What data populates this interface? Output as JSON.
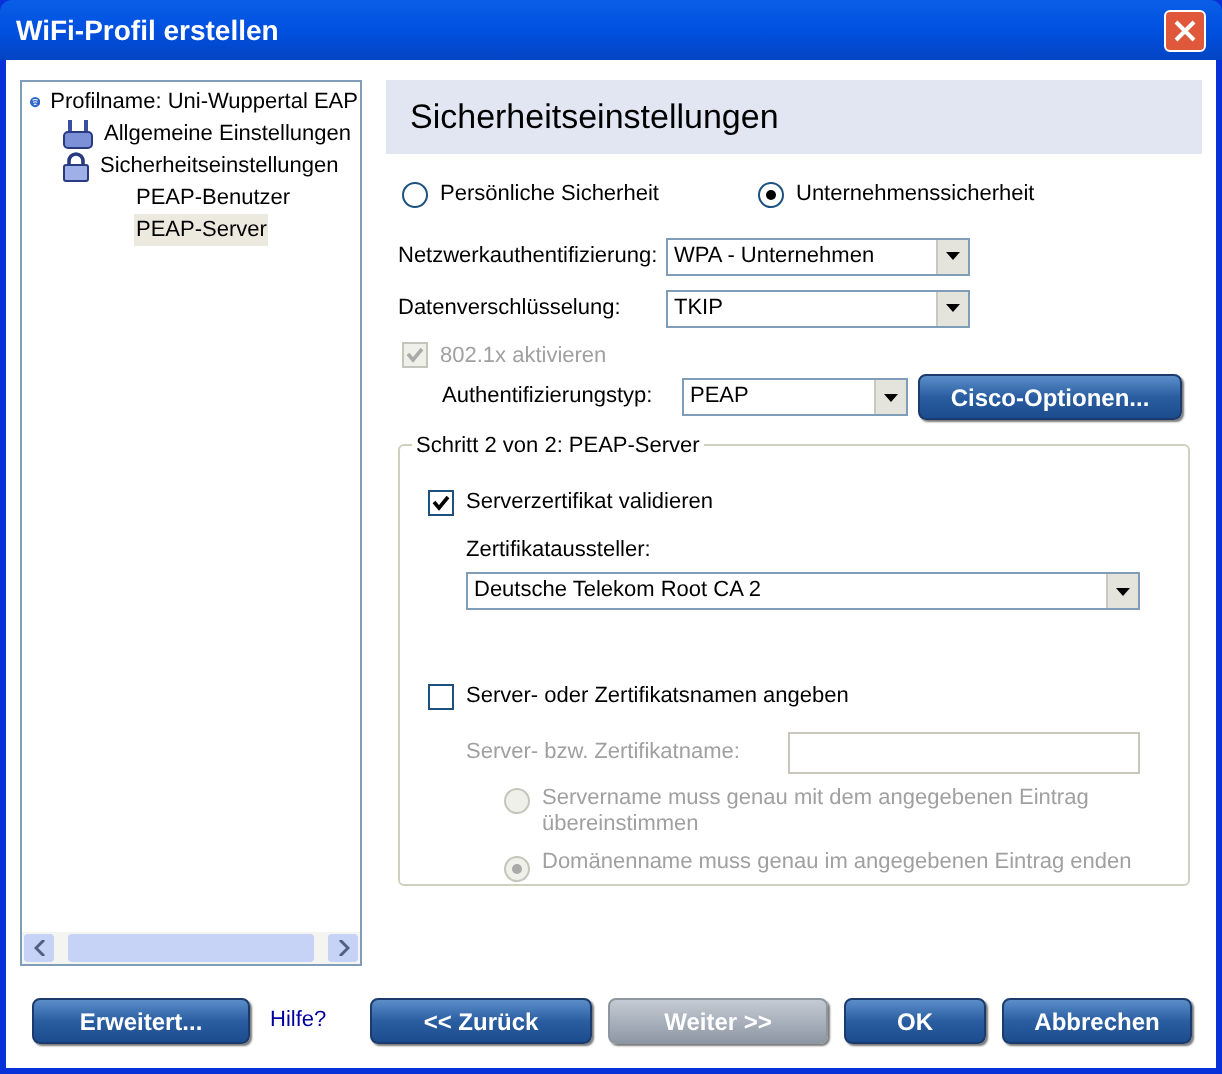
{
  "window": {
    "title": "WiFi-Profil erstellen"
  },
  "tree": [
    {
      "label": "Profilname: Uni-Wuppertal EAP",
      "selected": false,
      "children": [
        {
          "label": "Allgemeine Einstellungen",
          "selected": false
        },
        {
          "label": "Sicherheitseinstellungen",
          "selected": false,
          "children": [
            {
              "label": "PEAP-Benutzer",
              "selected": false
            },
            {
              "label": "PEAP-Server",
              "selected": true
            }
          ]
        }
      ]
    }
  ],
  "page_title": "Sicherheitseinstellungen",
  "security_mode": [
    {
      "label": "Persönliche Sicherheit",
      "selected": false
    },
    {
      "label": "Unternehmenssicherheit",
      "selected": true
    }
  ],
  "network_auth": {
    "label": "Netzwerkauthentifizierung:",
    "value": "WPA - Unternehmen"
  },
  "encryption": {
    "label": "Datenverschlüsselung:",
    "value": "TKIP"
  },
  "enable_8021x": {
    "label": "802.1x aktivieren",
    "checked": true,
    "disabled": true
  },
  "auth_type": {
    "label": "Authentifizierungstyp:",
    "value": "PEAP"
  },
  "cisco_button": "Cisco-Optionen...",
  "group": {
    "legend": "Schritt 2 von 2: PEAP-Server",
    "validate_cert": {
      "label": "Serverzertifikat validieren",
      "checked": true
    },
    "issuer": {
      "label": "Zertifikataussteller:",
      "value": "Deutsche Telekom Root CA 2"
    },
    "specify_names": {
      "label": "Server- oder Zertifikatsnamen angeben",
      "checked": false
    },
    "name_field": {
      "label": "Server- bzw. Zertifikatname:",
      "disabled": true
    },
    "name_rules": [
      {
        "label": "Servername muss genau mit dem angegebenen Eintrag übereinstimmen",
        "selected": false,
        "disabled": true
      },
      {
        "label": "Domänenname muss genau im angegebenen Eintrag enden",
        "selected": true,
        "disabled": true
      }
    ]
  },
  "help_link": "Hilfe?",
  "buttons": [
    {
      "label": "Erweitert...",
      "disabled": false
    },
    {
      "label": "<< Zurück",
      "disabled": false
    },
    {
      "label": "Weiter >>",
      "disabled": true
    },
    {
      "label": "OK",
      "disabled": false
    },
    {
      "label": "Abbrechen",
      "disabled": false
    }
  ]
}
